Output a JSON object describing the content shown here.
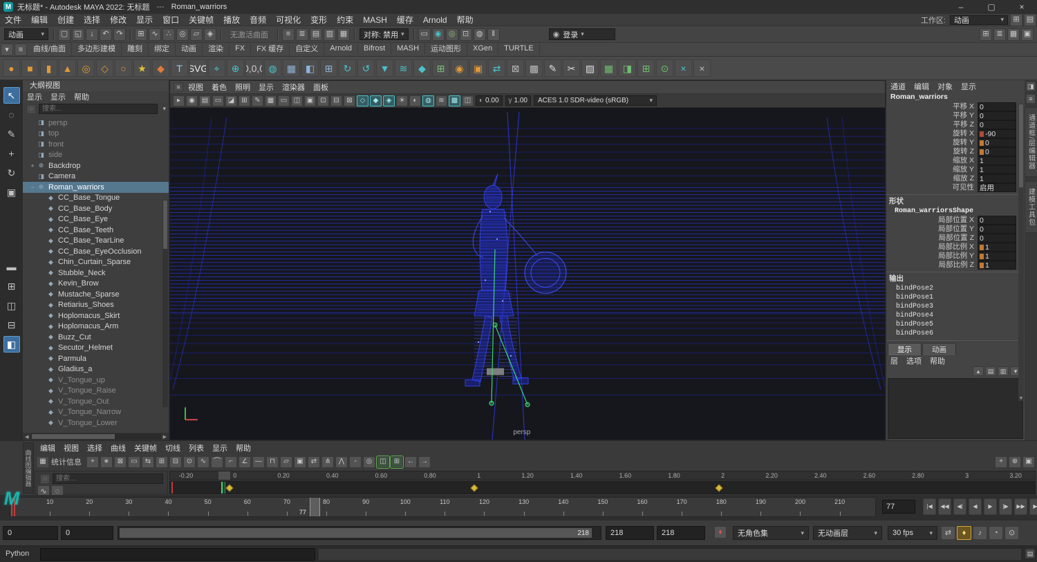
{
  "colors": {
    "selection": "#55788f",
    "wireframe": "#2a33cc",
    "wireframe_dim": "#1f24a8",
    "skeleton": "#3bd877",
    "key_diamond": "#d8b93a",
    "key_red": "#c23b3b",
    "accent_teal": "#49c3c9"
  },
  "titlebar": {
    "title": "无标题* - Autodesk MAYA 2022: 无标题",
    "sep": "---",
    "doc": "Roman_warriors",
    "controls": [
      {
        "n": "minimize-button",
        "g": "–"
      },
      {
        "n": "maximize-button",
        "g": "▢"
      },
      {
        "n": "close-button",
        "g": "×"
      }
    ]
  },
  "menubar": {
    "items": [
      "文件",
      "编辑",
      "创建",
      "选择",
      "修改",
      "显示",
      "窗口",
      "关键帧",
      "播放",
      "音频",
      "可视化",
      "变形",
      "约束",
      "MASH",
      "缓存",
      "Arnold",
      "帮助"
    ],
    "workspace_label": "工作区:",
    "workspace_value": "动画",
    "right_icons": [
      {
        "n": "workspace-options-icon",
        "g": "⊞"
      },
      {
        "n": "ui-toggle-icon",
        "g": "▤"
      }
    ]
  },
  "toolbar": {
    "selector": "动画",
    "file_icons": [
      {
        "n": "new-scene-icon",
        "g": "▢"
      },
      {
        "n": "open-scene-icon",
        "g": "◱"
      },
      {
        "n": "save-scene-icon",
        "g": "↓"
      },
      {
        "n": "undo-icon",
        "g": "↶"
      },
      {
        "n": "redo-icon",
        "g": "↷"
      }
    ],
    "snap_icons": [
      {
        "n": "snap-to-grid-icon",
        "g": "⊞"
      },
      {
        "n": "snap-to-curve-icon",
        "g": "∿"
      },
      {
        "n": "snap-to-point-icon",
        "g": "∴"
      },
      {
        "n": "snap-to-projected-center-icon",
        "g": "◎"
      },
      {
        "n": "snap-to-view-plane-icon",
        "g": "▱"
      },
      {
        "n": "make-live-icon",
        "g": "◈"
      }
    ],
    "no_active_surface": "无激活曲面",
    "editor_icons": [
      {
        "n": "inputs-icon",
        "g": "≡"
      },
      {
        "n": "outputs-icon",
        "g": "≣"
      },
      {
        "n": "attribute-editor-icon",
        "g": "▤"
      },
      {
        "n": "tool-settings-icon",
        "g": "▥"
      },
      {
        "n": "channel-box-icon",
        "g": "▦"
      }
    ],
    "symmetry_label": "对称: 禁用",
    "render_icons": [
      {
        "n": "render-view-icon",
        "g": "▭"
      },
      {
        "n": "render-frame-icon",
        "g": "◉",
        "c": "#49c3c9"
      },
      {
        "n": "ipr-render-icon",
        "g": "◎",
        "c": "#8fbf6f"
      },
      {
        "n": "render-settings-icon",
        "g": "⊡"
      },
      {
        "n": "hypershade-icon",
        "g": "◍"
      },
      {
        "n": "pause-viewport-icon",
        "g": "‖"
      }
    ],
    "login_label": "登录",
    "right_icons": [
      {
        "n": "grid-toggle-icon",
        "g": "⊞"
      },
      {
        "n": "frame-rate-display-icon",
        "g": "≣"
      },
      {
        "n": "panel-layout-icon",
        "g": "▦"
      },
      {
        "n": "fullscreen-icon",
        "g": "▣"
      }
    ]
  },
  "shelf": {
    "left_icons": [
      {
        "n": "shelf-tab-menu-icon",
        "g": "▾"
      },
      {
        "n": "shelf-editor-icon",
        "g": "≡"
      }
    ],
    "tabs": [
      "曲线/曲面",
      "多边形建模",
      "雕刻",
      "绑定",
      "动画",
      "渲染",
      "FX",
      "FX 缓存",
      "自定义",
      "Arnold",
      "Bifrost",
      "MASH",
      "运动图形",
      "XGen",
      "TURTLE"
    ],
    "icons": [
      {
        "n": "nurbs-sphere-icon",
        "g": "●",
        "c": "#e09a3a"
      },
      {
        "n": "nurbs-cube-icon",
        "g": "■",
        "c": "#e09a3a"
      },
      {
        "n": "nurbs-cylinder-icon",
        "g": "▮",
        "c": "#e09a3a"
      },
      {
        "n": "nurbs-cone-icon",
        "g": "▲",
        "c": "#e09a3a"
      },
      {
        "n": "nurbs-torus-icon",
        "g": "◎",
        "c": "#e09a3a"
      },
      {
        "n": "nurbs-plane-icon",
        "g": "◇",
        "c": "#e09a3a"
      },
      {
        "n": "nurbs-circle-icon",
        "g": "○",
        "c": "#e09a3a"
      },
      {
        "n": "star-polygon-icon",
        "g": "★",
        "c": "#e0c23a"
      },
      {
        "n": "four-point-star-icon",
        "g": "◆",
        "c": "#e07a3a"
      },
      {
        "n": "type-tool-icon",
        "g": "T",
        "c": "#8fd3ef"
      },
      {
        "n": "svg-tool-icon",
        "g": "SVG",
        "c": "#eeeeee",
        "cls": "txt"
      },
      {
        "n": "measure-tool-icon",
        "g": "⌖",
        "c": "#49c3c9"
      },
      {
        "n": "snap-align-icon",
        "g": "⊕",
        "c": "#49c3c9"
      },
      {
        "n": "move-to-origin-icon",
        "g": "0,0,0",
        "c": "#cccccc",
        "cls": "txt"
      },
      {
        "n": "paint-effects-icon",
        "g": "◍",
        "c": "#49c3c9"
      },
      {
        "n": "poly-grid-icon",
        "g": "▦",
        "c": "#8fb3d9"
      },
      {
        "n": "poly-extrude-icon",
        "g": "◧",
        "c": "#8fb3d9"
      },
      {
        "n": "poly-smooth-icon",
        "g": "⊞",
        "c": "#8fb3d9"
      },
      {
        "n": "rotate-cw-icon",
        "g": "↻",
        "c": "#49c3c9"
      },
      {
        "n": "rotate-ccw-icon",
        "g": "↺",
        "c": "#49c3c9"
      },
      {
        "n": "drop-to-floor-icon",
        "g": "▼",
        "c": "#49c3c9"
      },
      {
        "n": "stack-objects-icon",
        "g": "≋",
        "c": "#49c3c9"
      },
      {
        "n": "teal-cube-icon",
        "g": "◆",
        "c": "#49c3c9"
      },
      {
        "n": "grid-plus-icon",
        "g": "⊞",
        "c": "#7fbf7f"
      },
      {
        "n": "globe-icon",
        "g": "◉",
        "c": "#e09a3a"
      },
      {
        "n": "crate-icon",
        "g": "▣",
        "c": "#e09a3a"
      },
      {
        "n": "swap-arrows-icon",
        "g": "⇄",
        "c": "#49c3c9"
      },
      {
        "n": "lattice-icon",
        "g": "⊠",
        "c": "#b8b8b8"
      },
      {
        "n": "wireframe-box-icon",
        "g": "▩",
        "c": "#b8b8b8"
      },
      {
        "n": "pencil-tool-icon",
        "g": "✎",
        "c": "#dddddd"
      },
      {
        "n": "scissors-icon",
        "g": "✂",
        "c": "#dddddd"
      },
      {
        "n": "marker-tool-icon",
        "g": "▨",
        "c": "#dddddd"
      },
      {
        "n": "mash-network-icon",
        "g": "▦",
        "c": "#6fbf6f"
      },
      {
        "n": "mash-camera-icon",
        "g": "◨",
        "c": "#6fbf6f"
      },
      {
        "n": "mash-link-icon",
        "g": "⊞",
        "c": "#6fbf6f"
      },
      {
        "n": "mash-gear-icon",
        "g": "⊙",
        "c": "#6fbf6f"
      },
      {
        "n": "cross-tool-icon",
        "g": "×",
        "c": "#49c3c9"
      },
      {
        "n": "delete-tool-icon",
        "g": "×",
        "c": "#bbbbbb"
      }
    ]
  },
  "toolbox": {
    "tools": [
      {
        "n": "select-tool-icon",
        "g": "↖",
        "cls": "on"
      },
      {
        "n": "lasso-tool-icon",
        "g": "◌"
      },
      {
        "n": "paint-select-tool-icon",
        "g": "✎"
      },
      {
        "n": "move-tool-icon",
        "g": "+"
      },
      {
        "n": "rotate-tool-icon",
        "g": "↻"
      },
      {
        "n": "scale-tool-icon",
        "g": "▣"
      }
    ],
    "layouts": [
      {
        "n": "layout-single-pane-icon",
        "g": "▬"
      },
      {
        "n": "layout-four-pane-icon",
        "g": "⊞"
      },
      {
        "n": "layout-two-side-icon",
        "g": "◫"
      },
      {
        "n": "layout-two-stack-icon",
        "g": "⊟"
      },
      {
        "n": "layout-outliner-persp-icon",
        "g": "◧",
        "cls": "on"
      }
    ]
  },
  "outliner": {
    "title": "大纲视图",
    "menus": [
      "显示",
      "显示",
      "帮助"
    ],
    "search_placeholder": "搜索...",
    "items": [
      {
        "label": "persp",
        "type": "camera",
        "dim": true
      },
      {
        "label": "top",
        "type": "camera",
        "dim": true
      },
      {
        "label": "front",
        "type": "camera",
        "dim": true
      },
      {
        "label": "side",
        "type": "camera",
        "dim": true
      },
      {
        "label": "Backdrop",
        "type": "group",
        "expand": "+"
      },
      {
        "label": "Camera",
        "type": "camera"
      },
      {
        "label": "Roman_warriors",
        "type": "group",
        "expand": "−",
        "selected": true
      },
      {
        "label": "CC_Base_Tongue",
        "type": "mesh",
        "child": true
      },
      {
        "label": "CC_Base_Body",
        "type": "mesh",
        "child": true
      },
      {
        "label": "CC_Base_Eye",
        "type": "mesh",
        "child": true
      },
      {
        "label": "CC_Base_Teeth",
        "type": "mesh",
        "child": true
      },
      {
        "label": "CC_Base_TearLine",
        "type": "mesh",
        "child": true
      },
      {
        "label": "CC_Base_EyeOcclusion",
        "type": "mesh",
        "child": true
      },
      {
        "label": "Chin_Curtain_Sparse",
        "type": "mesh",
        "child": true
      },
      {
        "label": "Stubble_Neck",
        "type": "mesh",
        "child": true
      },
      {
        "label": "Kevin_Brow",
        "type": "mesh",
        "child": true
      },
      {
        "label": "Mustache_Sparse",
        "type": "mesh",
        "child": true
      },
      {
        "label": "Retiarius_Shoes",
        "type": "mesh",
        "child": true
      },
      {
        "label": "Hoplomacus_Skirt",
        "type": "mesh",
        "child": true
      },
      {
        "label": "Hoplomacus_Arm",
        "type": "mesh",
        "child": true
      },
      {
        "label": "Buzz_Cut",
        "type": "mesh",
        "child": true
      },
      {
        "label": "Secutor_Helmet",
        "type": "mesh",
        "child": true
      },
      {
        "label": "Parmula",
        "type": "mesh",
        "child": true
      },
      {
        "label": "Gladius_a",
        "type": "mesh",
        "child": true
      },
      {
        "label": "V_Tongue_up",
        "type": "mesh",
        "child": true,
        "dim": true
      },
      {
        "label": "V_Tongue_Raise",
        "type": "mesh",
        "child": true,
        "dim": true
      },
      {
        "label": "V_Tongue_Out",
        "type": "mesh",
        "child": true,
        "dim": true
      },
      {
        "label": "V_Tongue_Narrow",
        "type": "mesh",
        "child": true,
        "dim": true
      },
      {
        "label": "V_Tongue_Lower",
        "type": "mesh",
        "child": true,
        "dim": true
      }
    ]
  },
  "viewport": {
    "menus": [
      "视图",
      "着色",
      "照明",
      "显示",
      "渲染器",
      "面板"
    ],
    "icons": [
      {
        "n": "camera-select-icon",
        "g": "▸"
      },
      {
        "n": "camera-lock-icon",
        "g": "◉"
      },
      {
        "n": "camera-attributes-icon",
        "g": "▤"
      },
      {
        "n": "bookmark-icon",
        "g": "▭"
      },
      {
        "n": "image-plane-icon",
        "g": "◪"
      },
      {
        "n": "pan-zoom-icon",
        "g": "⊞"
      },
      {
        "n": "grease-pencil-icon",
        "g": "✎"
      },
      {
        "n": "grid-display-icon",
        "g": "▦"
      },
      {
        "n": "film-gate-icon",
        "g": "▭"
      },
      {
        "n": "resolution-gate-icon",
        "g": "◫"
      },
      {
        "n": "gate-mask-icon",
        "g": "▣"
      },
      {
        "n": "field-chart-icon",
        "g": "⊡"
      },
      {
        "n": "safe-action-icon",
        "g": "⊟"
      },
      {
        "n": "safe-title-icon",
        "g": "⊠"
      },
      {
        "n": "wireframe-display-icon",
        "g": "◇",
        "cls": "on"
      },
      {
        "n": "smooth-shade-icon",
        "g": "◆",
        "cls": "on"
      },
      {
        "n": "textured-display-icon",
        "g": "◈",
        "cls": "on"
      },
      {
        "n": "use-lights-icon",
        "g": "☀"
      },
      {
        "n": "shadows-icon",
        "g": "◐"
      },
      {
        "n": "screen-space-ao-icon",
        "g": "◍",
        "cls": "on"
      },
      {
        "n": "motion-blur-icon",
        "g": "≋"
      },
      {
        "n": "anti-alias-icon",
        "g": "▩",
        "cls": "on"
      },
      {
        "n": "xray-icon",
        "g": "◫"
      }
    ],
    "exposure": "0.00",
    "gamma": "1.00",
    "colorspace": "ACES 1.0 SDR-video (sRGB)",
    "camera_label": "persp"
  },
  "channelbox": {
    "menus": [
      "通道",
      "编辑",
      "对象",
      "显示"
    ],
    "object": "Roman_warriors",
    "channels": [
      {
        "name": "平移 X",
        "value": "0"
      },
      {
        "name": "平移 Y",
        "value": "0"
      },
      {
        "name": "平移 Z",
        "value": "0"
      },
      {
        "name": "旋转 X",
        "value": "-90",
        "chip": "#b04a3a"
      },
      {
        "name": "旋转 Y",
        "value": "0",
        "chip": "#c07a35"
      },
      {
        "name": "旋转 Z",
        "value": "0",
        "chip": "#c07a35"
      },
      {
        "name": "缩放 X",
        "value": "1"
      },
      {
        "name": "缩放 Y",
        "value": "1"
      },
      {
        "name": "缩放 Z",
        "value": "1"
      },
      {
        "name": "可见性",
        "value": "启用"
      }
    ],
    "shape_header": "形状",
    "shape_name": "Roman_warriorsShape",
    "shape_channels": [
      {
        "name": "局部位置 X",
        "value": "0"
      },
      {
        "name": "局部位置 Y",
        "value": "0"
      },
      {
        "name": "局部位置 Z",
        "value": "0"
      },
      {
        "name": "局部比例 X",
        "value": "1",
        "chip": "#c07a35"
      },
      {
        "name": "局部比例 Y",
        "value": "1",
        "chip": "#c07a35"
      },
      {
        "name": "局部比例 Z",
        "value": "1",
        "chip": "#c07a35"
      }
    ],
    "outputs_header": "输出",
    "outputs": [
      "bindPose2",
      "bindPose1",
      "bindPose3",
      "bindPose4",
      "bindPose5",
      "bindPose6"
    ],
    "bottom_tabs": [
      "显示",
      "动画"
    ],
    "layer_menus": [
      "层",
      "选项",
      "帮助"
    ],
    "layer_icons": [
      {
        "n": "layer-move-up-icon",
        "g": "▴"
      },
      {
        "n": "layer-new-empty-icon",
        "g": "▤"
      },
      {
        "n": "layer-new-from-selected-icon",
        "g": "▥"
      },
      {
        "n": "layer-options-icon",
        "g": "▾"
      }
    ]
  },
  "side_tabs": {
    "icons": [
      {
        "n": "sidebar-toggle-icon",
        "g": "◨"
      },
      {
        "n": "sidebar-pin-icon",
        "g": "≡"
      }
    ],
    "tabs": [
      "通道框/层编辑器",
      "建模工具包"
    ]
  },
  "graph_editor": {
    "panel_label": "曲线图编辑器",
    "menus": [
      "编辑",
      "视图",
      "选择",
      "曲线",
      "关键帧",
      "切线",
      "列表",
      "显示",
      "帮助"
    ],
    "stats_label": "统计信息",
    "search_placeholder": "搜索...",
    "left_icons": [
      {
        "n": "curve-filter-icon",
        "g": "∿"
      },
      {
        "n": "list-filter-icon",
        "g": "◌"
      }
    ],
    "icons": [
      {
        "n": "move-keys-icon",
        "g": "+"
      },
      {
        "n": "insert-keys-icon",
        "g": "∗"
      },
      {
        "n": "lattice-deform-keys-icon",
        "g": "⊠"
      },
      {
        "n": "region-keys-icon",
        "g": "▭"
      },
      {
        "n": "retime-keys-icon",
        "g": "⇆"
      },
      {
        "n": "frame-all-icon",
        "g": "⊞"
      },
      {
        "n": "frame-playback-icon",
        "g": "⊟"
      },
      {
        "n": "center-current-time-icon",
        "g": "⊙"
      },
      {
        "n": "auto-tangent-icon",
        "g": "∿"
      },
      {
        "n": "spline-tangent-icon",
        "g": "⌒"
      },
      {
        "n": "clamped-tangent-icon",
        "g": "⌐"
      },
      {
        "n": "linear-tangent-icon",
        "g": "∠"
      },
      {
        "n": "flat-tangent-icon",
        "g": "―"
      },
      {
        "n": "step-tangent-icon",
        "g": "⊓"
      },
      {
        "n": "plateau-tangent-icon",
        "g": "▱"
      },
      {
        "n": "buffer-curve-snapshot-icon",
        "g": "▣"
      },
      {
        "n": "swap-buffer-curve-icon",
        "g": "⇄"
      },
      {
        "n": "break-tangents-icon",
        "g": "⋔"
      },
      {
        "n": "unify-tangents-icon",
        "g": "⋀"
      },
      {
        "n": "free-tangent-weight-icon",
        "g": "◦"
      },
      {
        "n": "lock-tangent-weight-icon",
        "g": "◎"
      },
      {
        "n": "time-snap-icon",
        "g": "◫",
        "cls": "on-green"
      },
      {
        "n": "value-snap-icon",
        "g": "⊞",
        "cls": "on-green"
      },
      {
        "n": "pre-infinity-icon",
        "g": "←"
      },
      {
        "n": "post-infinity-icon",
        "g": "→"
      }
    ],
    "right_icons": [
      {
        "n": "graph-pan-icon",
        "g": "+"
      },
      {
        "n": "graph-zoom-icon",
        "g": "⊕"
      },
      {
        "n": "graph-frame-icon",
        "g": "▣"
      }
    ],
    "ruler": [
      "-0.20",
      "0",
      "0.20",
      "0.40",
      "0.60",
      "0.80",
      "1",
      "1.20",
      "1.40",
      "1.60",
      "1.80",
      "2",
      "2.20",
      "2.40",
      "2.60",
      "2.80",
      "3",
      "3.20"
    ],
    "key_times": [
      0,
      1,
      2
    ]
  },
  "timeline": {
    "ticks": [
      "10",
      "20",
      "30",
      "40",
      "50",
      "60",
      "70",
      "80",
      "90",
      "100",
      "110",
      "120",
      "130",
      "140",
      "150",
      "160",
      "170",
      "180",
      "190",
      "200",
      "210"
    ],
    "current_frame": "77",
    "key_frames": [
      "0"
    ],
    "playback": [
      {
        "n": "go-to-start-button",
        "g": "|◀"
      },
      {
        "n": "step-back-key-button",
        "g": "◀◀"
      },
      {
        "n": "step-back-frame-button",
        "g": "◀|"
      },
      {
        "n": "play-backward-button",
        "g": "◀"
      },
      {
        "n": "play-forward-button",
        "g": "▶"
      },
      {
        "n": "step-forward-frame-button",
        "g": "|▶"
      },
      {
        "n": "step-forward-key-button",
        "g": "▶▶"
      },
      {
        "n": "go-to-end-button",
        "g": "▶|"
      }
    ]
  },
  "range_slider": {
    "start": "0",
    "anim_start": "0",
    "bar_label": "218",
    "anim_end": "218",
    "end": "218",
    "key_icon": {
      "n": "set-key-icon",
      "g": "♦"
    },
    "char_set": "无角色集",
    "anim_layer": "无动画层",
    "fps": "30 fps",
    "right_icons": [
      {
        "n": "loop-mode-icon",
        "g": "⇄"
      },
      {
        "n": "auto-key-icon",
        "g": "♦",
        "cls": "on-amber"
      },
      {
        "n": "mute-sound-icon",
        "g": "♪"
      },
      {
        "n": "playback-speed-icon",
        "g": "◔"
      },
      {
        "n": "animation-preferences-icon",
        "g": "⊙"
      }
    ]
  },
  "command_line": {
    "label": "Python"
  }
}
